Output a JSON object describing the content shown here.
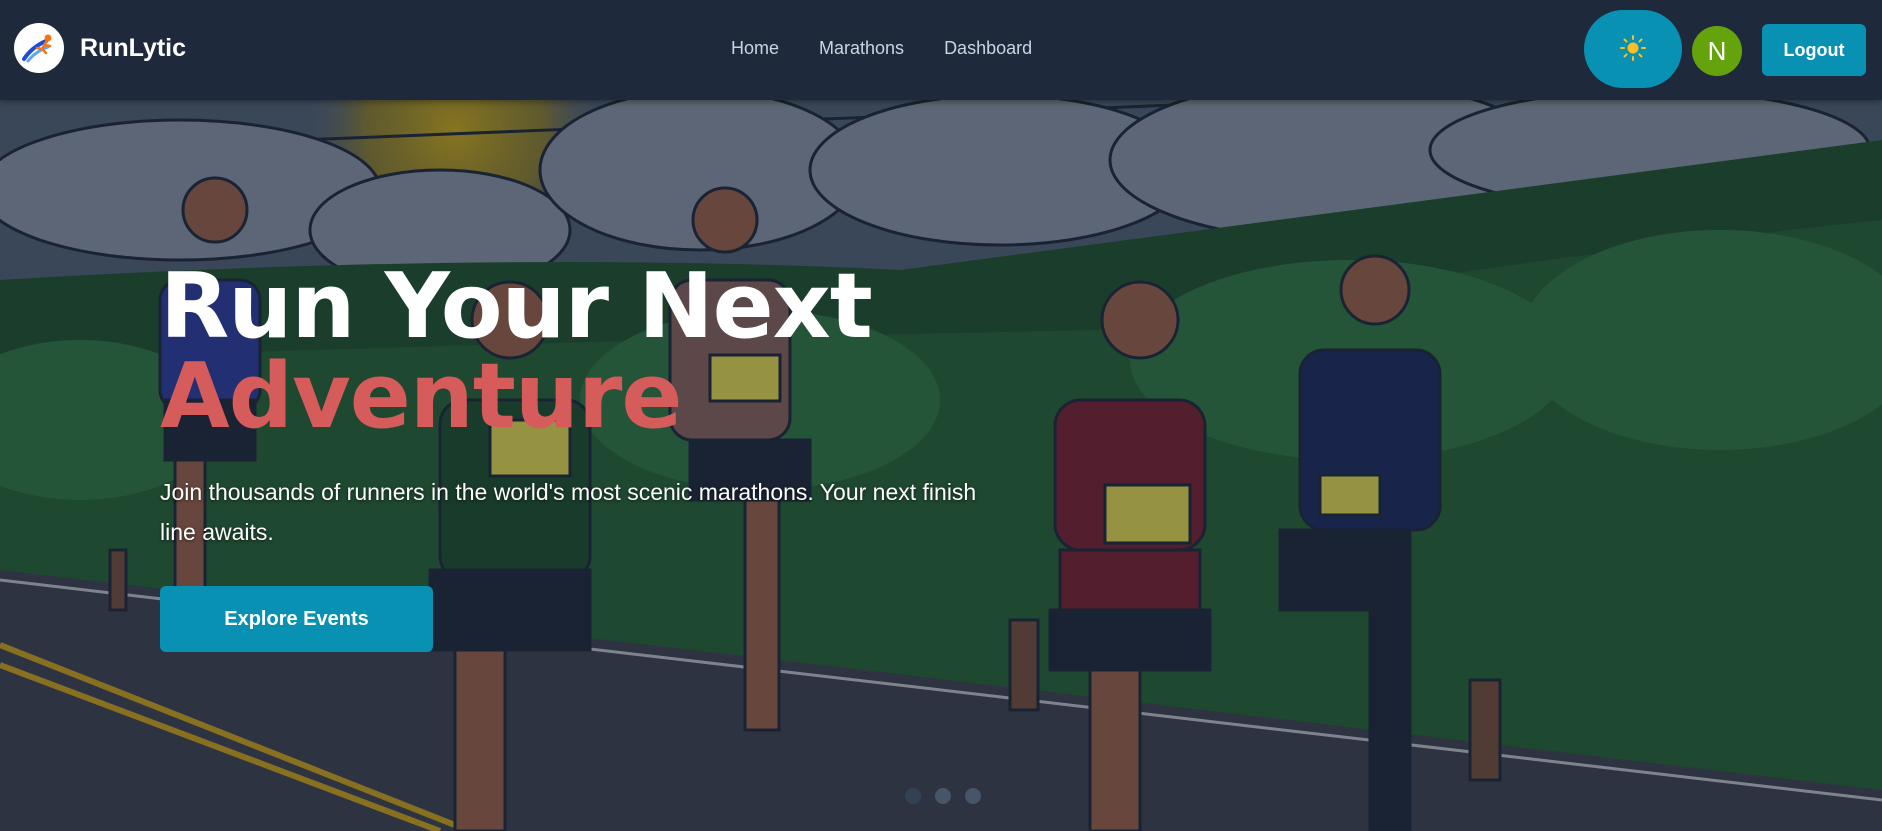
{
  "header": {
    "brand_name": "RunLytic",
    "nav_links": [
      {
        "label": "Home"
      },
      {
        "label": "Marathons"
      },
      {
        "label": "Dashboard"
      }
    ],
    "theme_toggle_icon": "sun-icon",
    "avatar_initial": "N",
    "logout_label": "Logout"
  },
  "hero": {
    "title_line1": "Run Your Next",
    "title_line2": "Adventure",
    "subtitle": "Join thousands of runners in the world's most scenic marathons. Your next finish line awaits.",
    "cta_label": "Explore Events",
    "slide_count": 3,
    "active_slide": 1
  },
  "colors": {
    "navbar_bg": "#1e293b",
    "accent": "#0891b2",
    "title_accent": "#d65c5c",
    "avatar_bg": "#65a30d"
  }
}
